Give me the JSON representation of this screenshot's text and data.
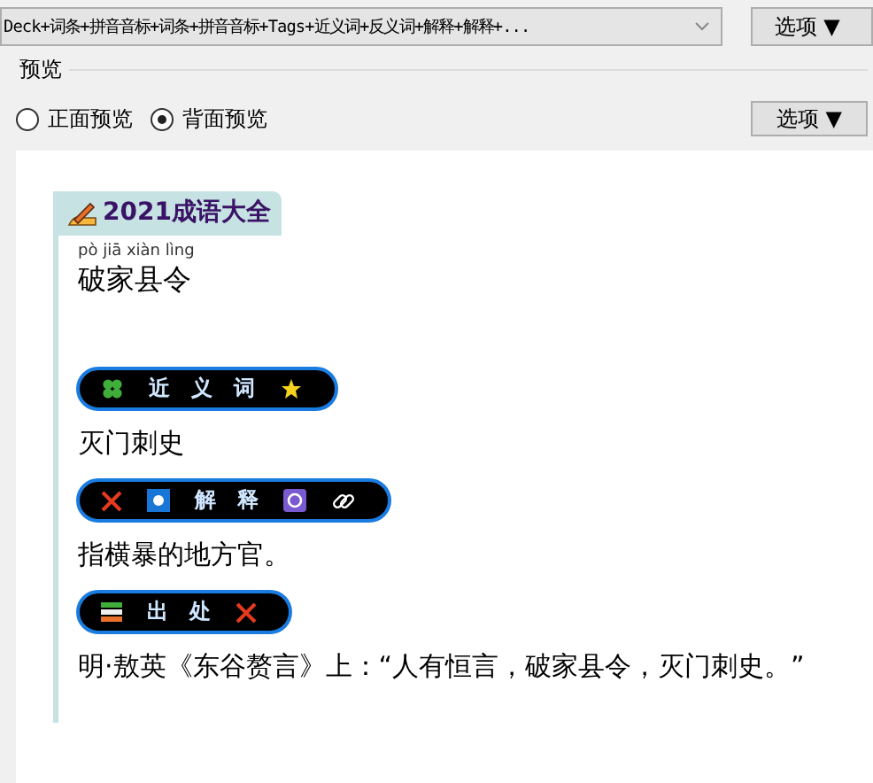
{
  "note_type": {
    "value": "Deck+词条+拼音音标+词条+拼音音标+Tags+近义词+反义词+解释+解释+..."
  },
  "top_options_button": "选项 ▼",
  "preview_group": {
    "title": "预览",
    "sides": [
      {
        "label": "正面预览",
        "selected": false
      },
      {
        "label": "背面预览",
        "selected": true
      }
    ],
    "options_button": "选项 ▼"
  },
  "card": {
    "deck_badge": "2021成语大全",
    "pinyin": "pò jiā xiàn lìng",
    "word": "破家县令",
    "sections": [
      {
        "label": "近义词",
        "content": "灭门刺史"
      },
      {
        "label": "解释",
        "content": "指横暴的地方官。"
      },
      {
        "label": "出处",
        "content": "明·敖英《东谷赘言》上：“人有恒言，破家县令，灭门刺史。”"
      }
    ]
  }
}
